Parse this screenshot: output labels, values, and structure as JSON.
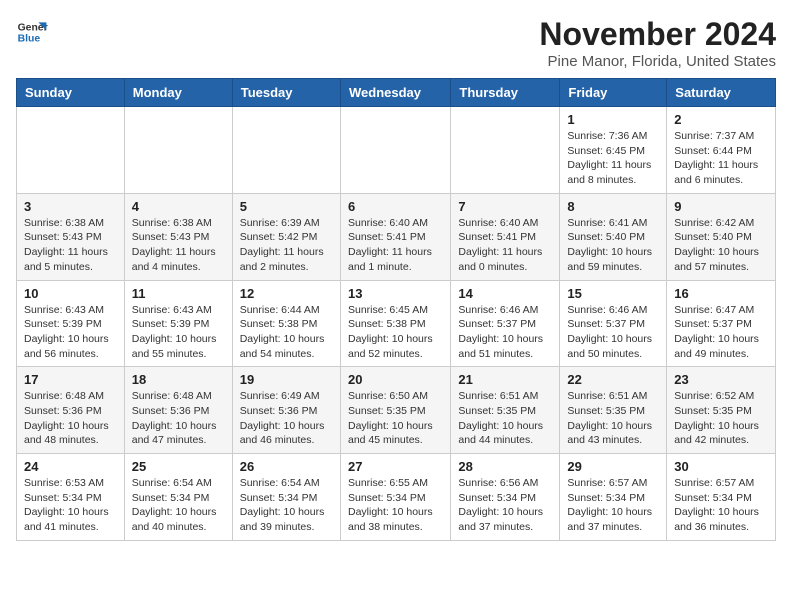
{
  "header": {
    "logo_line1": "General",
    "logo_line2": "Blue",
    "month": "November 2024",
    "location": "Pine Manor, Florida, United States"
  },
  "weekdays": [
    "Sunday",
    "Monday",
    "Tuesday",
    "Wednesday",
    "Thursday",
    "Friday",
    "Saturday"
  ],
  "weeks": [
    [
      {
        "day": "",
        "info": ""
      },
      {
        "day": "",
        "info": ""
      },
      {
        "day": "",
        "info": ""
      },
      {
        "day": "",
        "info": ""
      },
      {
        "day": "",
        "info": ""
      },
      {
        "day": "1",
        "info": "Sunrise: 7:36 AM\nSunset: 6:45 PM\nDaylight: 11 hours\nand 8 minutes."
      },
      {
        "day": "2",
        "info": "Sunrise: 7:37 AM\nSunset: 6:44 PM\nDaylight: 11 hours\nand 6 minutes."
      }
    ],
    [
      {
        "day": "3",
        "info": "Sunrise: 6:38 AM\nSunset: 5:43 PM\nDaylight: 11 hours\nand 5 minutes."
      },
      {
        "day": "4",
        "info": "Sunrise: 6:38 AM\nSunset: 5:43 PM\nDaylight: 11 hours\nand 4 minutes."
      },
      {
        "day": "5",
        "info": "Sunrise: 6:39 AM\nSunset: 5:42 PM\nDaylight: 11 hours\nand 2 minutes."
      },
      {
        "day": "6",
        "info": "Sunrise: 6:40 AM\nSunset: 5:41 PM\nDaylight: 11 hours\nand 1 minute."
      },
      {
        "day": "7",
        "info": "Sunrise: 6:40 AM\nSunset: 5:41 PM\nDaylight: 11 hours\nand 0 minutes."
      },
      {
        "day": "8",
        "info": "Sunrise: 6:41 AM\nSunset: 5:40 PM\nDaylight: 10 hours\nand 59 minutes."
      },
      {
        "day": "9",
        "info": "Sunrise: 6:42 AM\nSunset: 5:40 PM\nDaylight: 10 hours\nand 57 minutes."
      }
    ],
    [
      {
        "day": "10",
        "info": "Sunrise: 6:43 AM\nSunset: 5:39 PM\nDaylight: 10 hours\nand 56 minutes."
      },
      {
        "day": "11",
        "info": "Sunrise: 6:43 AM\nSunset: 5:39 PM\nDaylight: 10 hours\nand 55 minutes."
      },
      {
        "day": "12",
        "info": "Sunrise: 6:44 AM\nSunset: 5:38 PM\nDaylight: 10 hours\nand 54 minutes."
      },
      {
        "day": "13",
        "info": "Sunrise: 6:45 AM\nSunset: 5:38 PM\nDaylight: 10 hours\nand 52 minutes."
      },
      {
        "day": "14",
        "info": "Sunrise: 6:46 AM\nSunset: 5:37 PM\nDaylight: 10 hours\nand 51 minutes."
      },
      {
        "day": "15",
        "info": "Sunrise: 6:46 AM\nSunset: 5:37 PM\nDaylight: 10 hours\nand 50 minutes."
      },
      {
        "day": "16",
        "info": "Sunrise: 6:47 AM\nSunset: 5:37 PM\nDaylight: 10 hours\nand 49 minutes."
      }
    ],
    [
      {
        "day": "17",
        "info": "Sunrise: 6:48 AM\nSunset: 5:36 PM\nDaylight: 10 hours\nand 48 minutes."
      },
      {
        "day": "18",
        "info": "Sunrise: 6:48 AM\nSunset: 5:36 PM\nDaylight: 10 hours\nand 47 minutes."
      },
      {
        "day": "19",
        "info": "Sunrise: 6:49 AM\nSunset: 5:36 PM\nDaylight: 10 hours\nand 46 minutes."
      },
      {
        "day": "20",
        "info": "Sunrise: 6:50 AM\nSunset: 5:35 PM\nDaylight: 10 hours\nand 45 minutes."
      },
      {
        "day": "21",
        "info": "Sunrise: 6:51 AM\nSunset: 5:35 PM\nDaylight: 10 hours\nand 44 minutes."
      },
      {
        "day": "22",
        "info": "Sunrise: 6:51 AM\nSunset: 5:35 PM\nDaylight: 10 hours\nand 43 minutes."
      },
      {
        "day": "23",
        "info": "Sunrise: 6:52 AM\nSunset: 5:35 PM\nDaylight: 10 hours\nand 42 minutes."
      }
    ],
    [
      {
        "day": "24",
        "info": "Sunrise: 6:53 AM\nSunset: 5:34 PM\nDaylight: 10 hours\nand 41 minutes."
      },
      {
        "day": "25",
        "info": "Sunrise: 6:54 AM\nSunset: 5:34 PM\nDaylight: 10 hours\nand 40 minutes."
      },
      {
        "day": "26",
        "info": "Sunrise: 6:54 AM\nSunset: 5:34 PM\nDaylight: 10 hours\nand 39 minutes."
      },
      {
        "day": "27",
        "info": "Sunrise: 6:55 AM\nSunset: 5:34 PM\nDaylight: 10 hours\nand 38 minutes."
      },
      {
        "day": "28",
        "info": "Sunrise: 6:56 AM\nSunset: 5:34 PM\nDaylight: 10 hours\nand 37 minutes."
      },
      {
        "day": "29",
        "info": "Sunrise: 6:57 AM\nSunset: 5:34 PM\nDaylight: 10 hours\nand 37 minutes."
      },
      {
        "day": "30",
        "info": "Sunrise: 6:57 AM\nSunset: 5:34 PM\nDaylight: 10 hours\nand 36 minutes."
      }
    ]
  ]
}
